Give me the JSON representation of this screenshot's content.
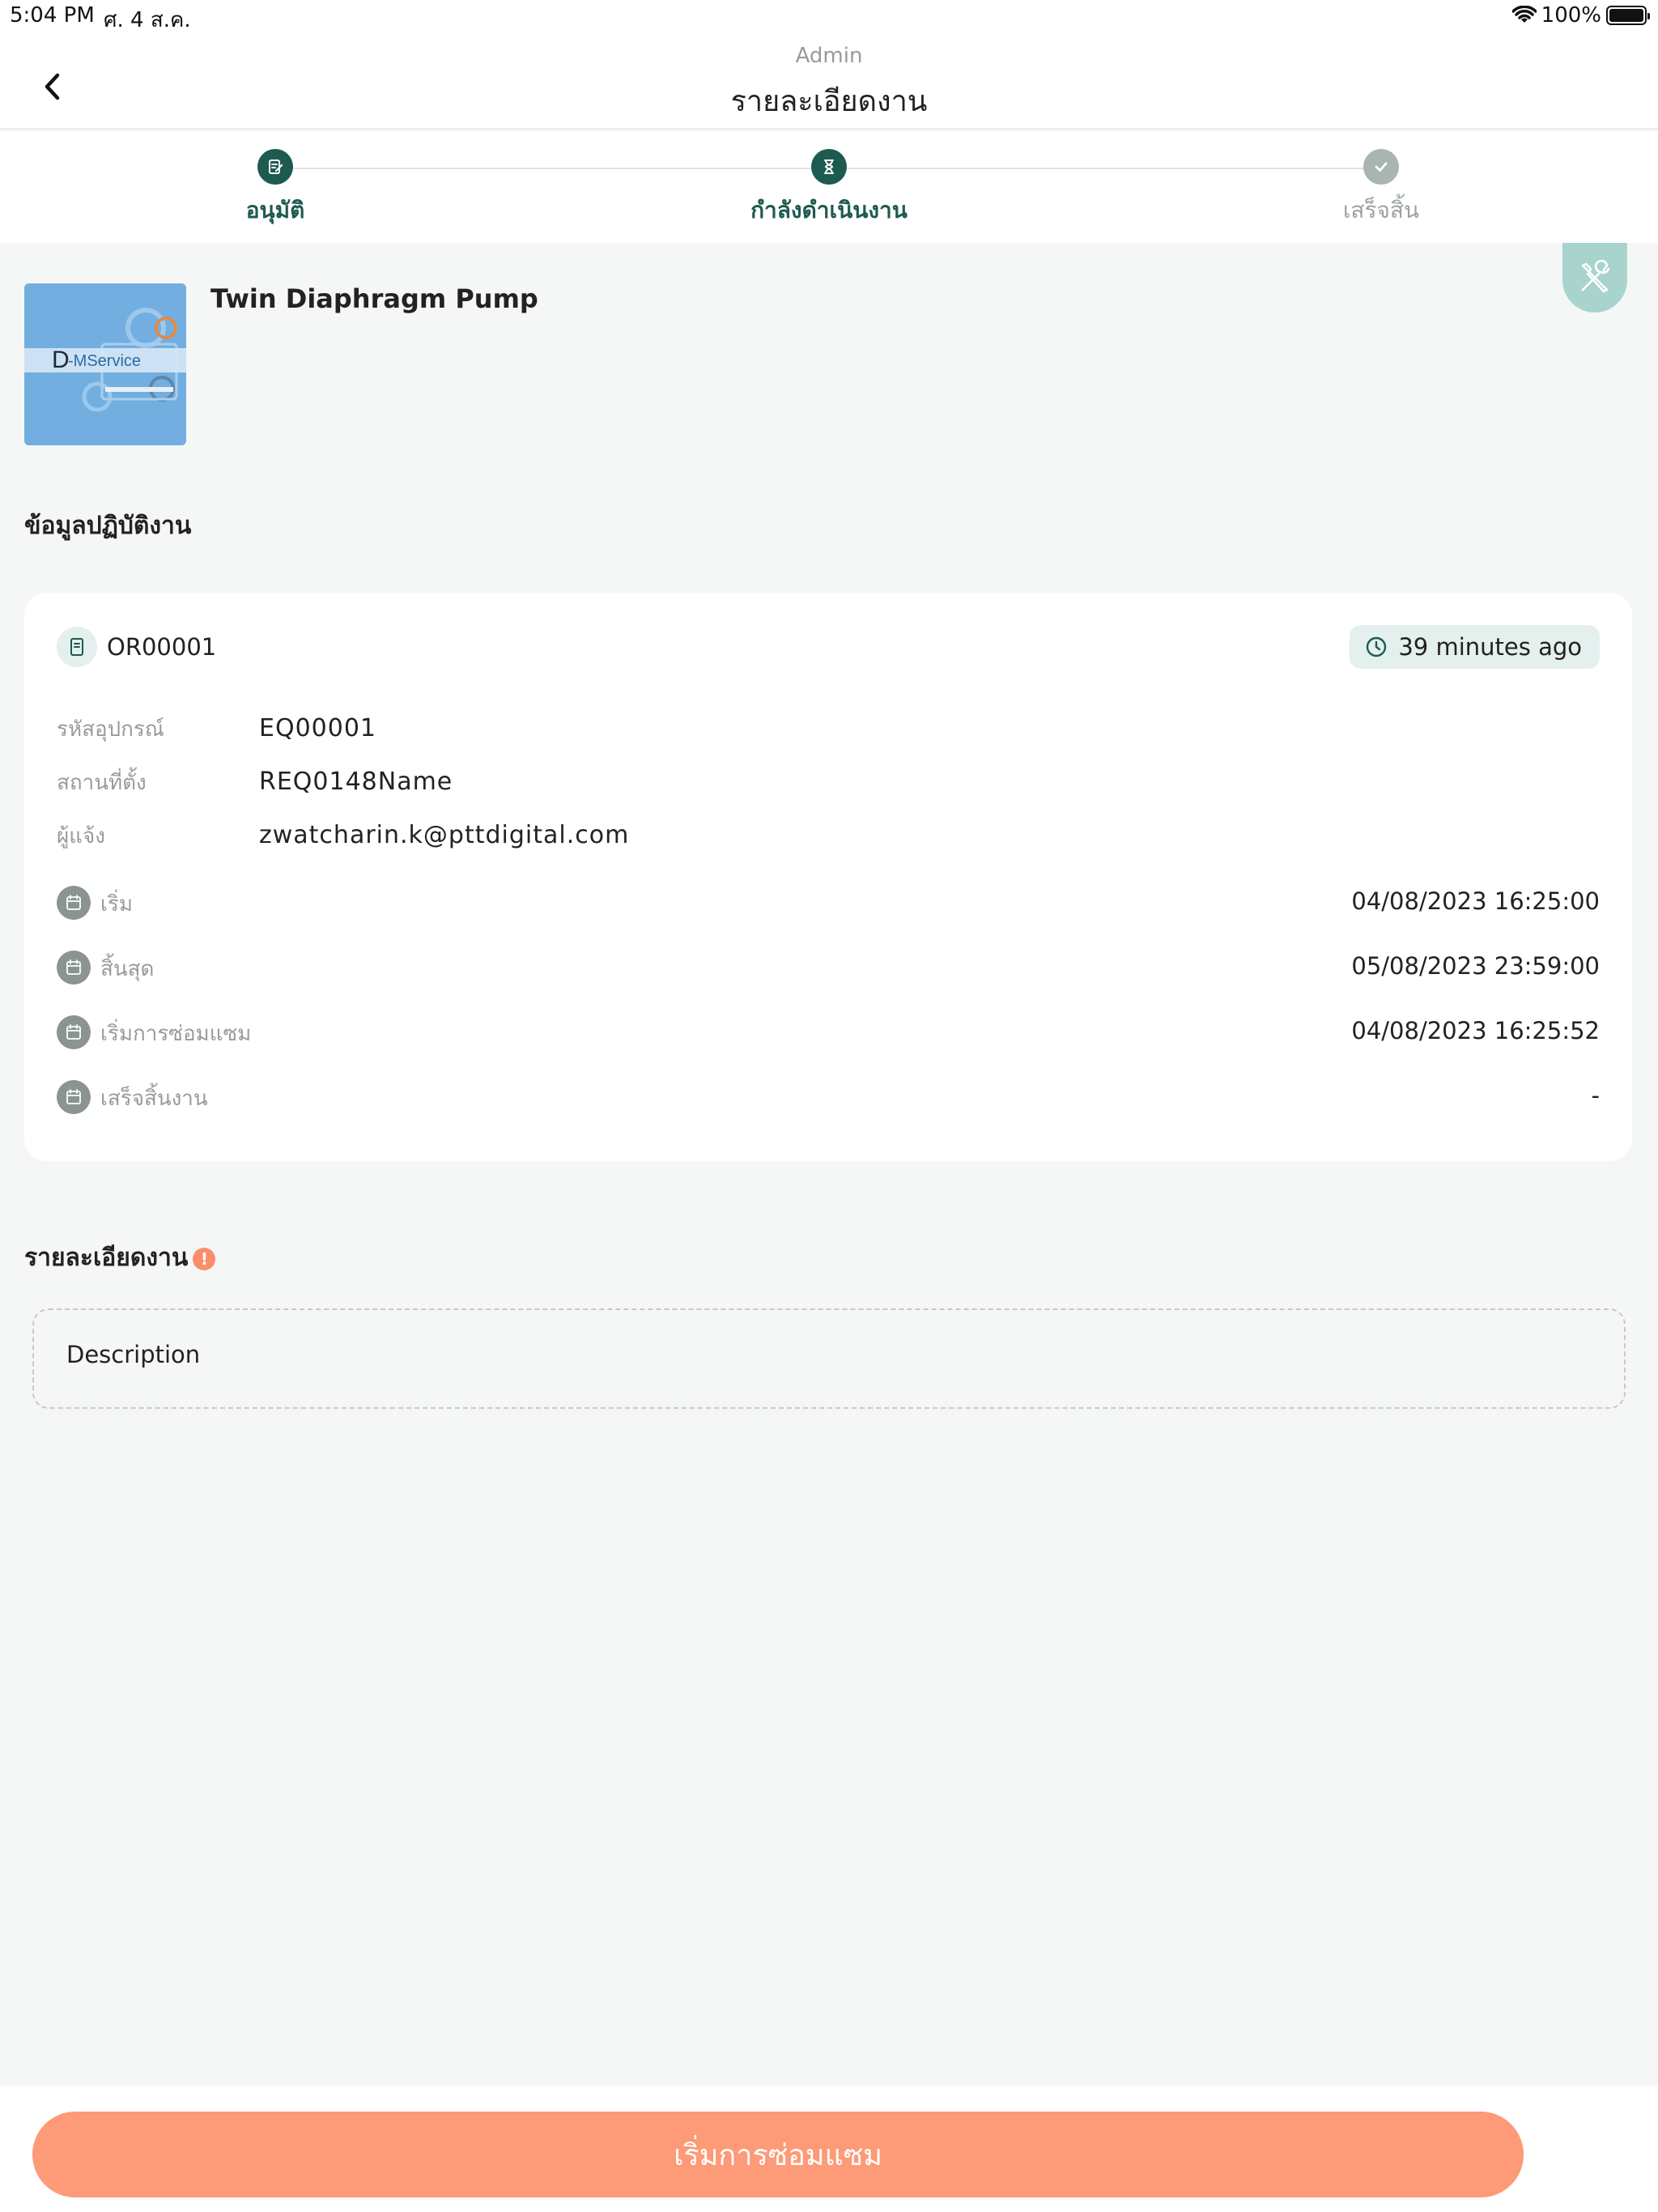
{
  "status_bar": {
    "time": "5:04 PM",
    "date": "ศ. 4 ส.ค.",
    "battery": "100%"
  },
  "header": {
    "subtitle": "Admin",
    "title": "รายละเอียดงาน"
  },
  "stepper": {
    "steps": [
      {
        "label": "อนุมัติ",
        "state": "done",
        "icon": "approve-icon",
        "color": "#1d5a4f"
      },
      {
        "label": "กำลังดำเนินงาน",
        "state": "current",
        "icon": "hourglass-icon",
        "color": "#1d5a4f"
      },
      {
        "label": "เสร็จสิ้น",
        "state": "pending",
        "icon": "check-icon",
        "color": "#a9b5b1"
      }
    ]
  },
  "equipment": {
    "image_logo_text": "D-MService",
    "name": "Twin Diaphragm Pump"
  },
  "work_info": {
    "section_title": "ข้อมูลปฏิบัติงาน",
    "order_id": "OR00001",
    "elapsed": "39 minutes ago",
    "fields": [
      {
        "label": "รหัสอุปกรณ์",
        "value": "EQ00001"
      },
      {
        "label": "สถานที่ตั้ง",
        "value": "REQ0148Name"
      },
      {
        "label": "ผู้แจ้ง",
        "value": "zwatcharin.k@pttdigital.com"
      }
    ],
    "dates": [
      {
        "label": "เริ่ม",
        "value": "04/08/2023 16:25:00"
      },
      {
        "label": "สิ้นสุด",
        "value": "05/08/2023 23:59:00"
      },
      {
        "label": "เริ่มการซ่อมแซม",
        "value": "04/08/2023 16:25:52"
      },
      {
        "label": "เสร็จสิ้นงาน",
        "value": "-"
      }
    ]
  },
  "job_detail": {
    "section_title": "รายละเอียดงาน",
    "required_mark": "!",
    "description_placeholder": "Description"
  },
  "actions": {
    "start_repair_label": "เริ่มการซ่อมแซม"
  },
  "colors": {
    "primary": "#1d5a4f",
    "accent": "#fd9a77",
    "badge_bg": "#e3f0ed",
    "fab_bg": "#a9d4cd"
  }
}
